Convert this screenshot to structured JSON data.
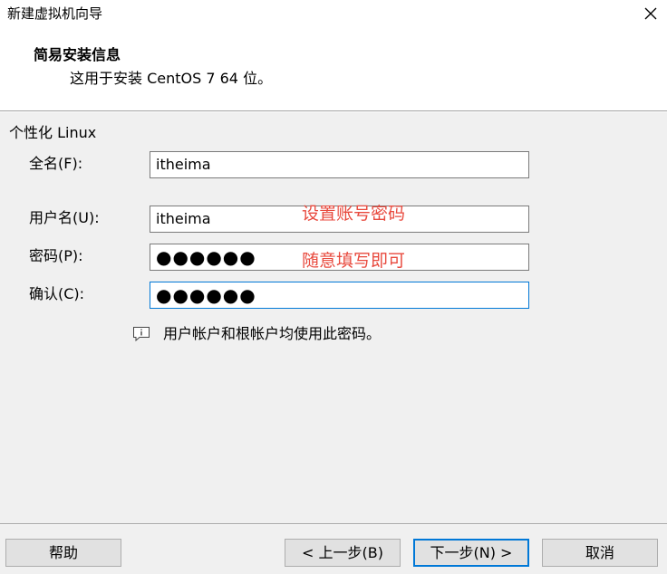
{
  "window": {
    "title": "新建虚拟机向导",
    "close_icon": "close-icon"
  },
  "header": {
    "title": "简易安装信息",
    "subtitle": "这用于安装 CentOS 7 64 位。"
  },
  "form": {
    "group_label": "个性化 Linux",
    "full_name": {
      "label": "全名(F):",
      "value": "itheima"
    },
    "username": {
      "label": "用户名(U):",
      "value": "itheima"
    },
    "password": {
      "label": "密码(P):",
      "value": "●●●●●●"
    },
    "confirm": {
      "label": "确认(C):",
      "value": "●●●●●●"
    }
  },
  "annotations": {
    "set_account": "设置账号密码",
    "fill_any": "随意填写即可",
    "color": "#e84a3e"
  },
  "info": {
    "icon": "info-icon",
    "text": "用户帐户和根帐户均使用此密码。"
  },
  "footer": {
    "help": "帮助",
    "back": "< 上一步(B)",
    "next": "下一步(N) >",
    "cancel": "取消"
  },
  "colors": {
    "focus_border": "#0078d7",
    "panel_bg": "#f0f0f0"
  }
}
